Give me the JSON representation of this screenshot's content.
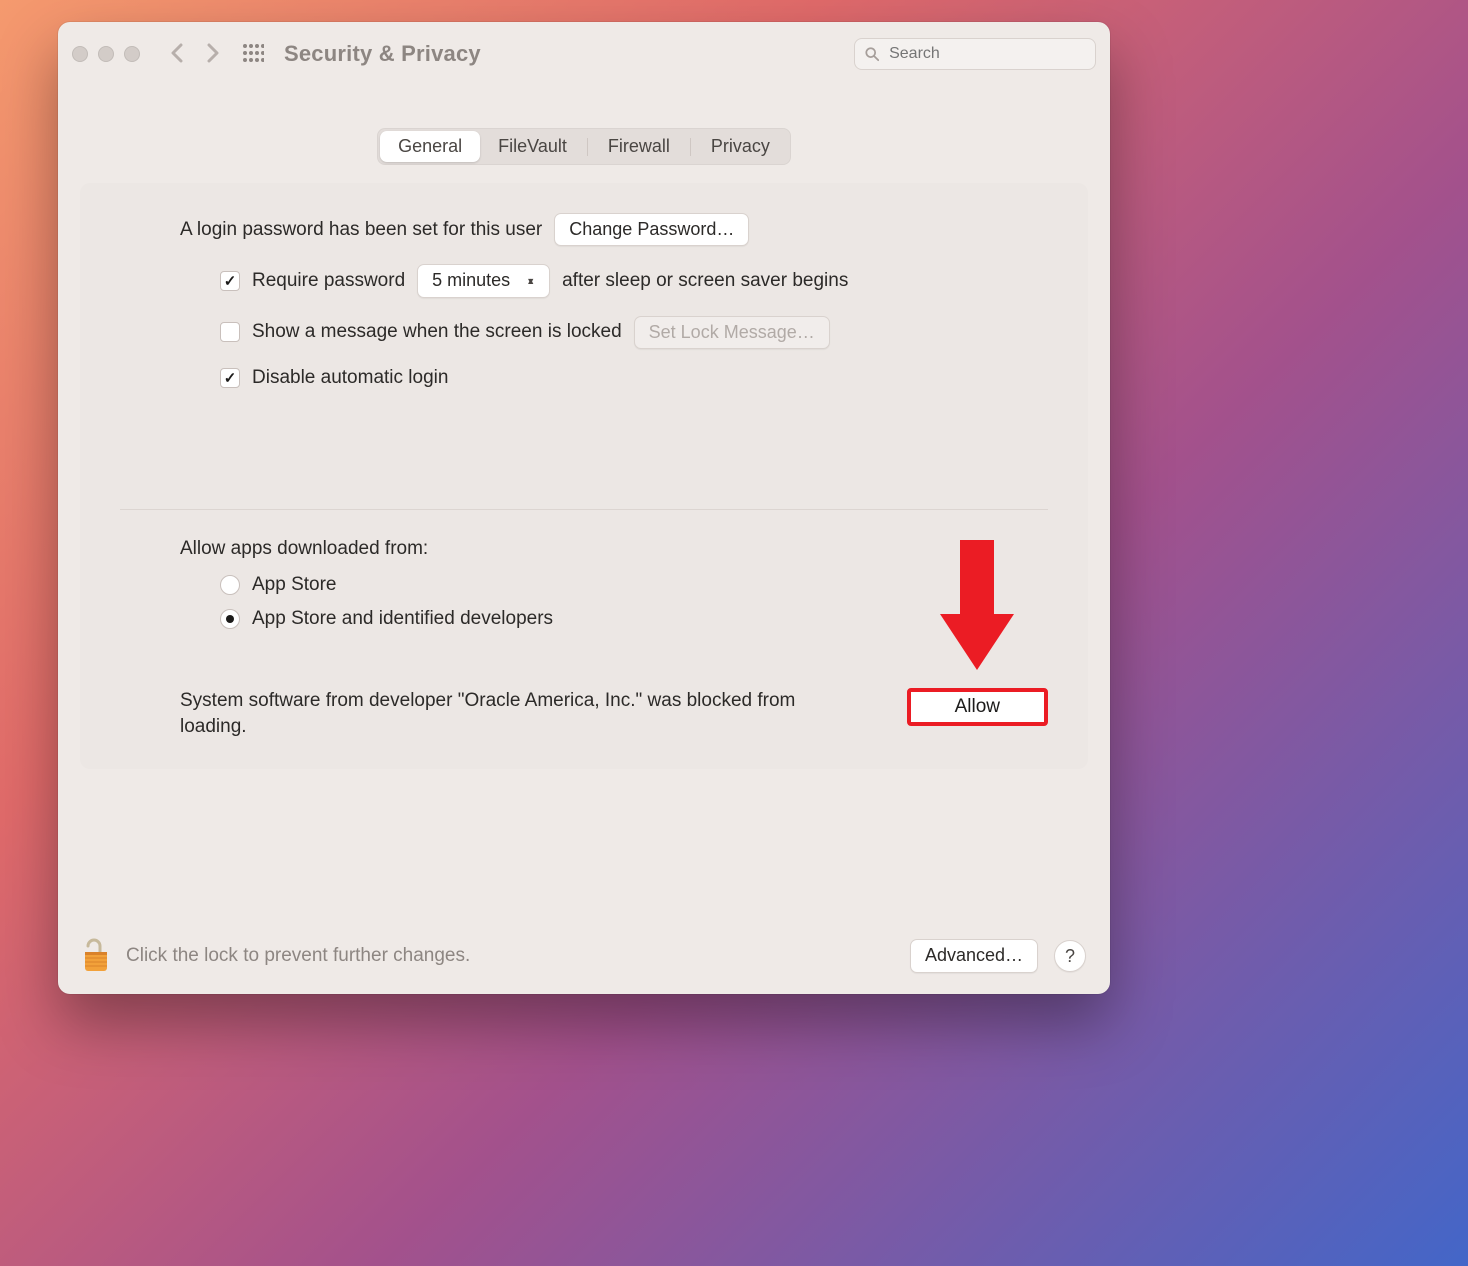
{
  "toolbar": {
    "title": "Security & Privacy",
    "search_placeholder": "Search"
  },
  "tabs": {
    "general": "General",
    "filevault": "FileVault",
    "firewall": "Firewall",
    "privacy": "Privacy",
    "active": "general"
  },
  "login_section": {
    "password_set_label": "A login password has been set for this user",
    "change_password_button": "Change Password…",
    "require_password_label": "Require password",
    "require_password_checked": true,
    "delay_value": "5 minutes",
    "after_sleep_label": "after sleep or screen saver begins",
    "show_message_label": "Show a message when the screen is locked",
    "show_message_checked": false,
    "set_lock_message_button": "Set Lock Message…",
    "disable_auto_login_label": "Disable automatic login",
    "disable_auto_login_checked": true
  },
  "allow_apps_section": {
    "title": "Allow apps downloaded from:",
    "option1": "App Store",
    "option2": "App Store and identified developers",
    "selected": "option2"
  },
  "blocked_software": {
    "message": "System software from developer \"Oracle America, Inc.\" was blocked from loading.",
    "allow_button": "Allow"
  },
  "footer": {
    "lock_text": "Click the lock to prevent further changes.",
    "advanced_button": "Advanced…",
    "help": "?"
  },
  "annotation": {
    "arrow_points_to": "allow-button",
    "arrow_color": "#eb1c24"
  }
}
